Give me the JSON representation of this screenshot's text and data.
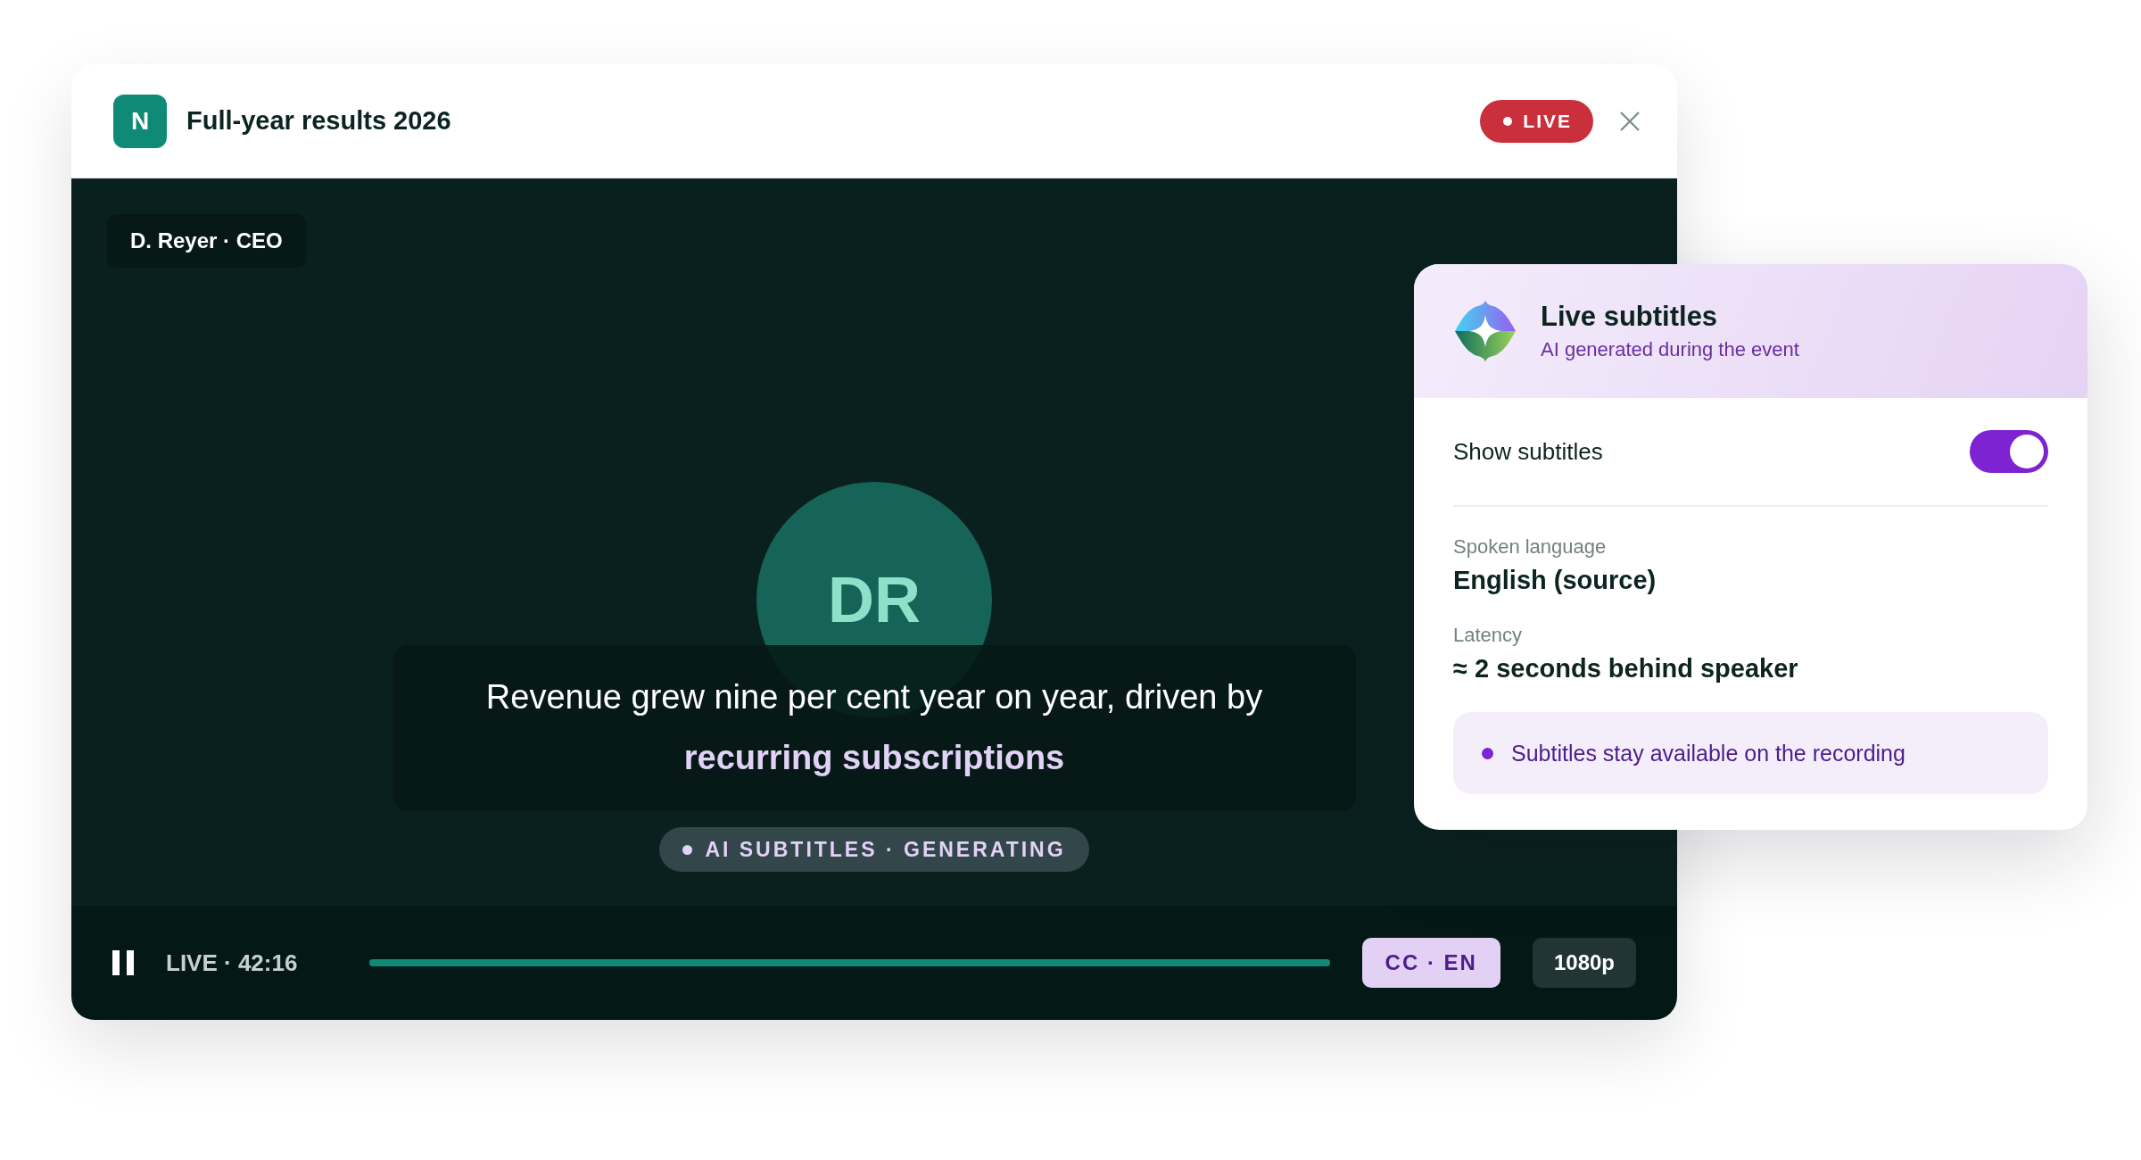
{
  "player": {
    "logo": "N",
    "title": "Full-year results 2026",
    "live_badge": "LIVE",
    "speaker_tag": "D. Reyer · CEO",
    "avatar_initials": "DR",
    "caption": "Revenue grew nine per cent year on year, driven by **recurring subscriptions**",
    "caption_status": "AI SUBTITLES · GENERATING",
    "controls": {
      "playing": true,
      "time": "LIVE · 42:16",
      "progress": {
        "level": 1
      },
      "cc_button": {
        "label": "CC · EN",
        "on": true
      },
      "quality": "1080p"
    }
  },
  "panel": {
    "title": "Live subtitles",
    "subtitle": "AI generated during the event",
    "toggle": {
      "label": "Show subtitles",
      "on": true
    },
    "fields": [
      {
        "label": "Spoken language",
        "value": "English (source)"
      },
      {
        "label": "Latency",
        "value": "≈ 2 seconds behind speaker"
      }
    ],
    "note": "Subtitles stay available on the recording"
  }
}
